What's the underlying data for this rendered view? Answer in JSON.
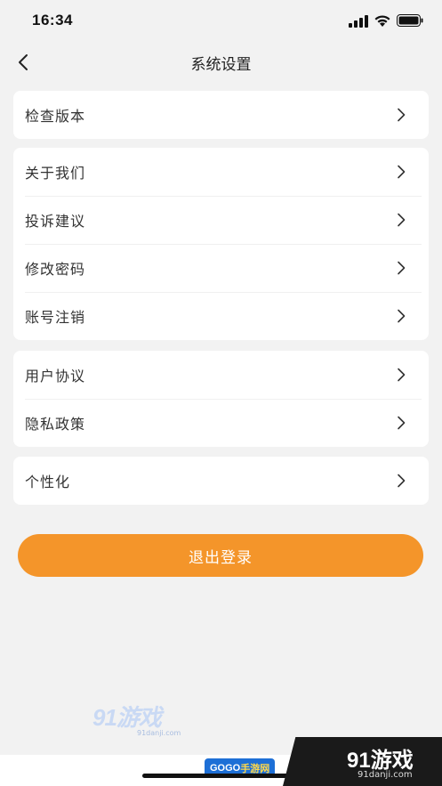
{
  "status_bar": {
    "time": "16:34"
  },
  "nav": {
    "title": "系统设置"
  },
  "sections": [
    {
      "items": [
        {
          "label": "检查版本"
        }
      ]
    },
    {
      "items": [
        {
          "label": "关于我们"
        },
        {
          "label": "投诉建议"
        },
        {
          "label": "修改密码"
        },
        {
          "label": "账号注销"
        }
      ]
    },
    {
      "items": [
        {
          "label": "用户协议"
        },
        {
          "label": "隐私政策"
        }
      ]
    },
    {
      "items": [
        {
          "label": "个性化"
        }
      ]
    }
  ],
  "logout": {
    "label": "退出登录",
    "color": "#f4952a"
  },
  "watermark": {
    "brand": "91游戏",
    "url": "91danji.com"
  },
  "corner_badge": {
    "brand": "91游戏",
    "url": "91danji.com",
    "gogo_prefix": "GOGO",
    "gogo_suffix": "手游网"
  }
}
